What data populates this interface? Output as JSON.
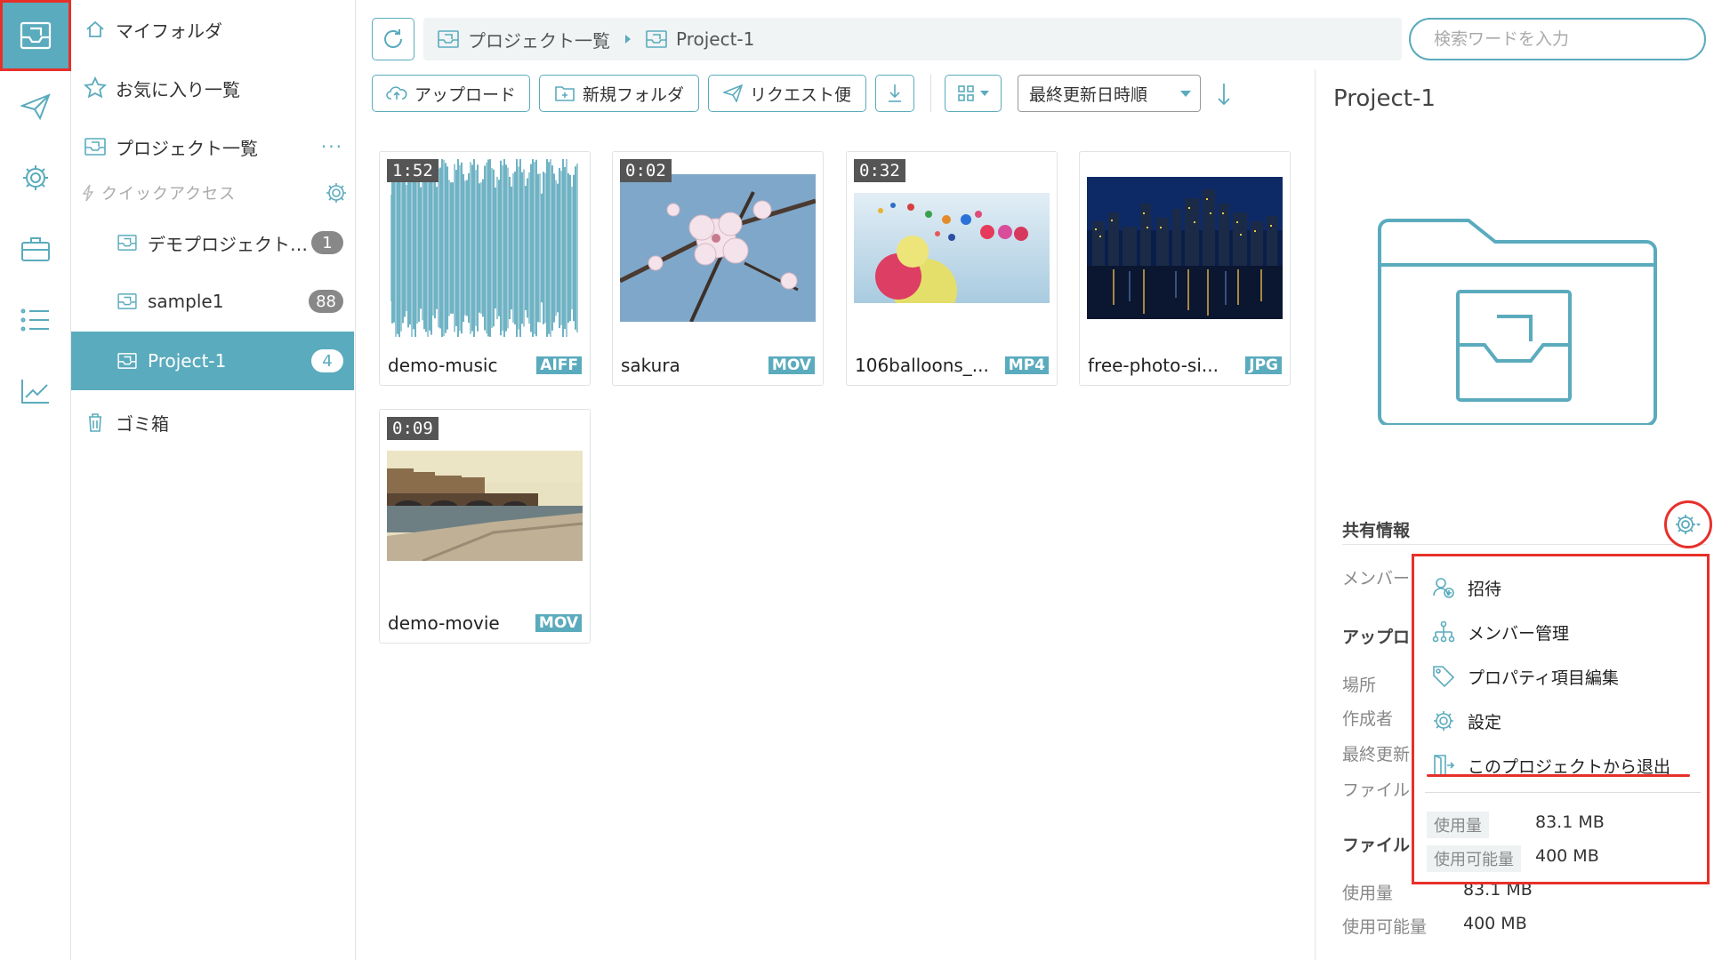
{
  "rail": {
    "items": [
      {
        "icon": "inbox-icon",
        "active": true
      },
      {
        "icon": "paper-plane-icon"
      },
      {
        "icon": "gear-icon"
      },
      {
        "icon": "briefcase-icon"
      },
      {
        "icon": "list-icon"
      },
      {
        "icon": "chart-icon"
      }
    ]
  },
  "nav": {
    "my_folder": "マイフォルダ",
    "favorites": "お気に入り一覧",
    "projects": "プロジェクト一覧",
    "more": "···",
    "quick_access": "クイックアクセス",
    "items": [
      {
        "label": "デモプロジェクト…",
        "count": "1"
      },
      {
        "label": "sample1",
        "count": "88"
      },
      {
        "label": "Project-1",
        "count": "4",
        "active": true
      }
    ],
    "trash": "ゴミ箱"
  },
  "breadcrumb": {
    "root": "プロジェクト一覧",
    "current": "Project-1"
  },
  "search": {
    "placeholder": "検索ワードを入力"
  },
  "toolbar": {
    "upload": "アップロード",
    "new_folder": "新規フォルダ",
    "request": "リクエスト便",
    "sort": "最終更新日時順"
  },
  "files": [
    {
      "name": "demo-music",
      "ext": "AIFF",
      "duration": "1:52",
      "kind": "audio"
    },
    {
      "name": "sakura",
      "ext": "MOV",
      "duration": "0:02",
      "kind": "sakura"
    },
    {
      "name": "106balloons_...",
      "ext": "MP4",
      "duration": "0:32",
      "kind": "balloons"
    },
    {
      "name": "free-photo-si...",
      "ext": "JPG",
      "duration": "",
      "kind": "city"
    },
    {
      "name": "demo-movie",
      "ext": "MOV",
      "duration": "0:09",
      "kind": "bridge"
    }
  ],
  "detail": {
    "title": "Project-1",
    "share_info": "共有情報",
    "member": "メンバー",
    "upload": "アップロ",
    "place": "場所",
    "creator": "作成者",
    "last_updated": "最終更新",
    "file_label": "ファイル",
    "file_section": "ファイル",
    "usage_label": "使用量",
    "usage_value": "83.1 MB",
    "available_label": "使用可能量",
    "available_value": "400 MB"
  },
  "menu": {
    "items": [
      {
        "label": "招待",
        "icon": "invite-user-icon"
      },
      {
        "label": "メンバー管理",
        "icon": "org-chart-icon"
      },
      {
        "label": "プロパティ項目編集",
        "icon": "tag-icon"
      },
      {
        "label": "設定",
        "icon": "gear-icon"
      },
      {
        "label": "このプロジェクトから退出",
        "icon": "exit-door-icon"
      }
    ],
    "usage_label": "使用量",
    "usage_value": "83.1 MB",
    "available_label": "使用可能量",
    "available_value": "400 MB"
  },
  "colors": {
    "accent": "#5aabbd",
    "highlight": "#e7302a"
  }
}
